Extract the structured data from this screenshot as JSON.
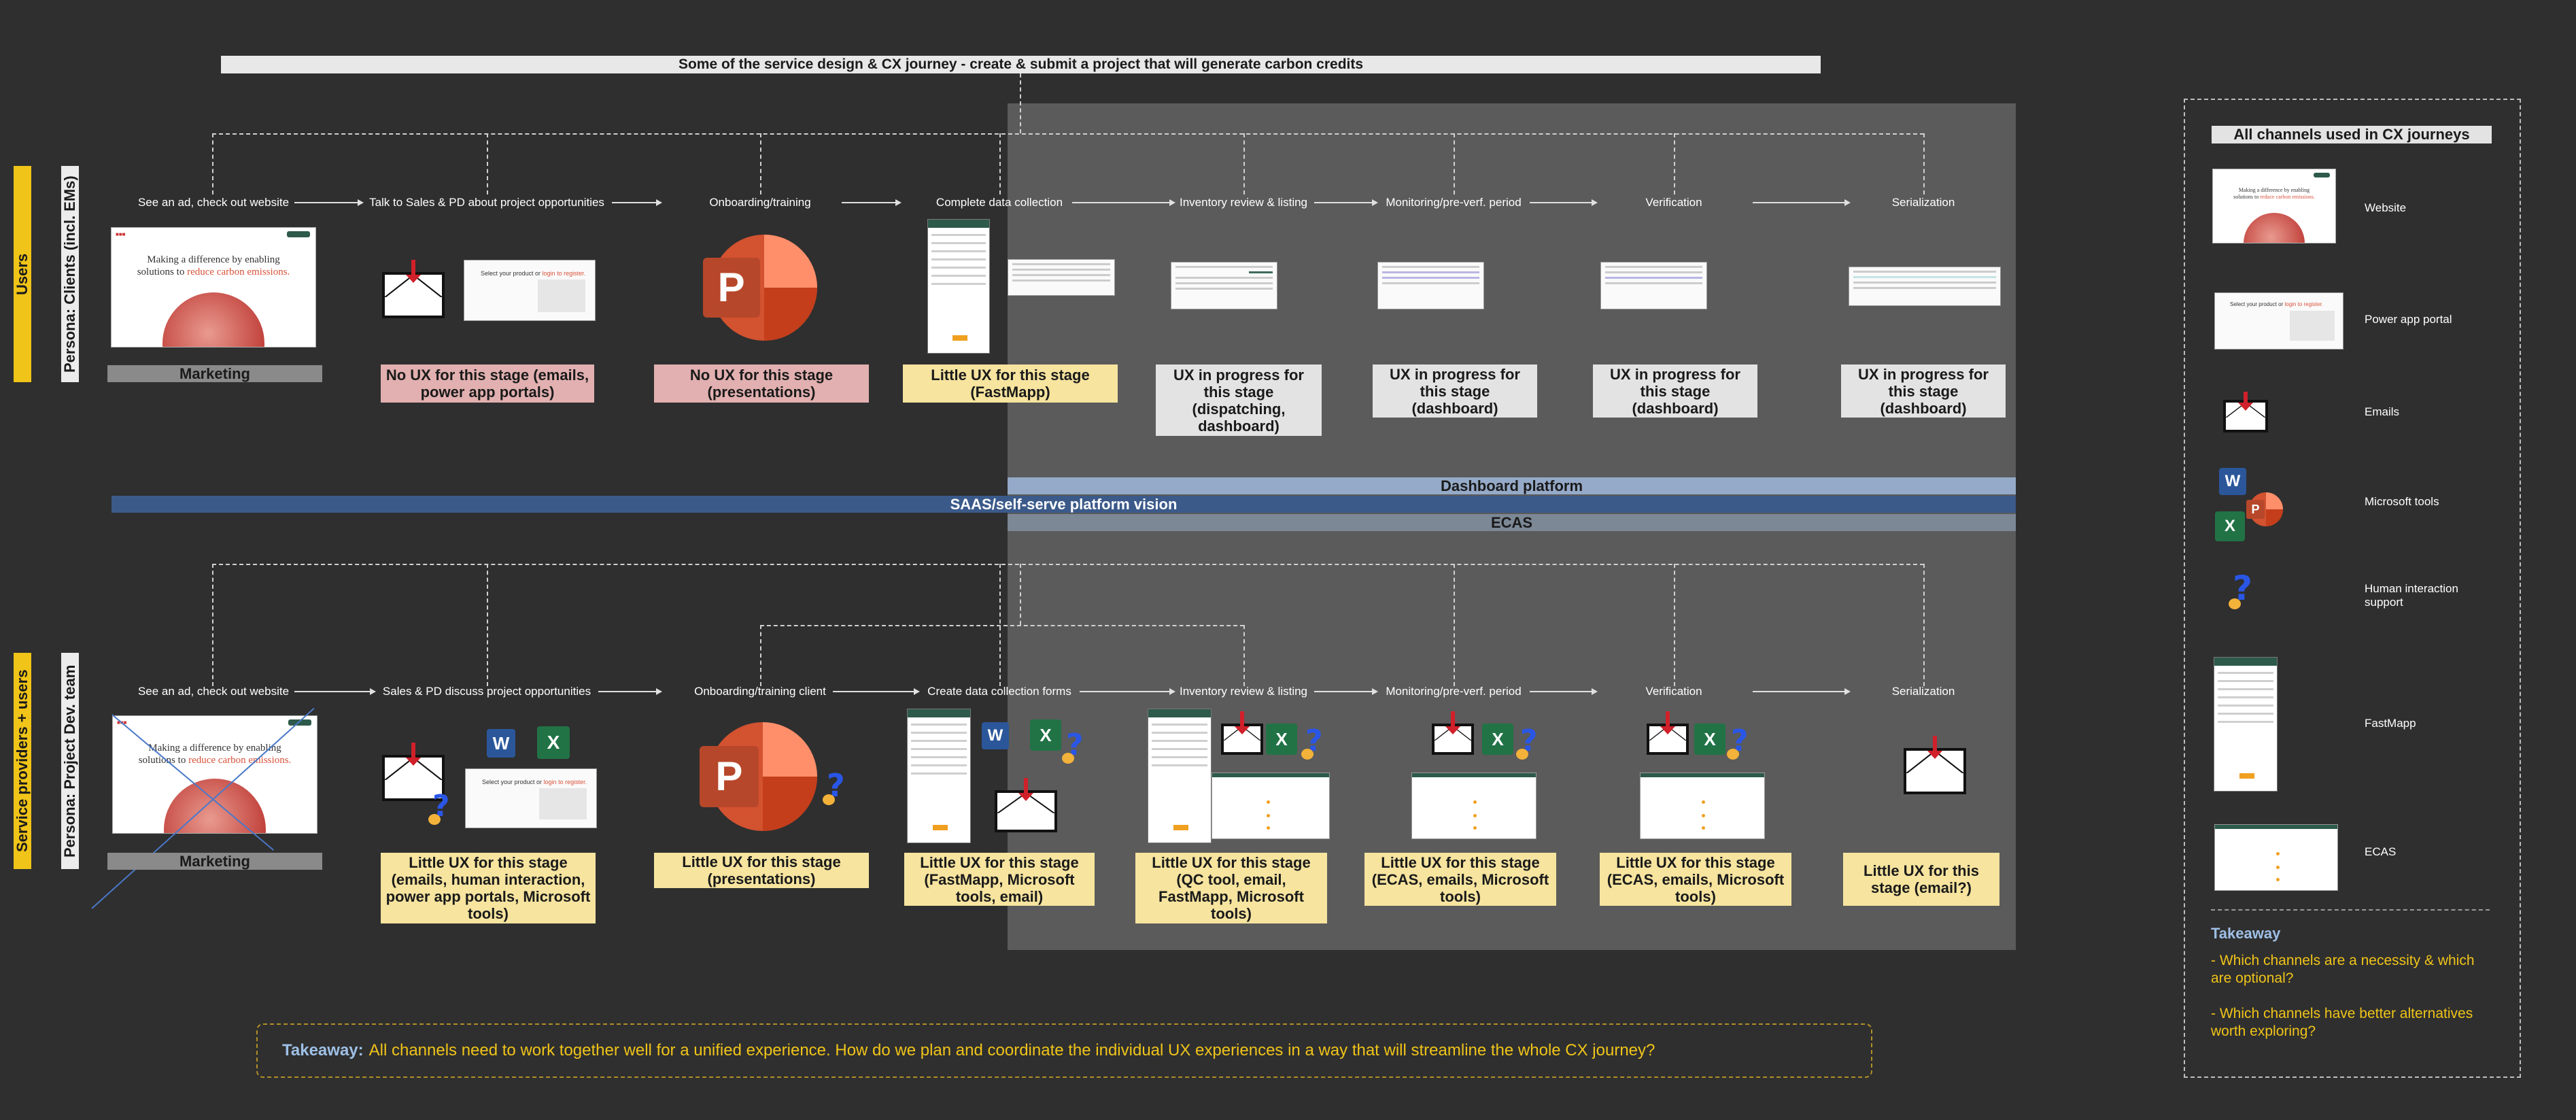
{
  "title": "Some of the service design & CX journey - create & submit a project that will generate carbon credits",
  "rows": {
    "users_label": "Users",
    "clients_label": "Persona: Clients (incl. EMs)",
    "providers_label": "Service providers + users",
    "pd_team_label": "Persona: Project Dev. team"
  },
  "top_stages": [
    "See an ad, check out website",
    "Talk to Sales & PD about project opportunities",
    "Onboarding/training",
    "Complete data collection",
    "Inventory review & listing",
    "Monitoring/pre-verf. period",
    "Verification",
    "Serialization"
  ],
  "bottom_stages": [
    "See an ad, check out website",
    "Sales & PD discuss project opportunities",
    "Onboarding/training client",
    "Create data collection forms",
    "Inventory review & listing",
    "Monitoring/pre-verf. period",
    "Verification",
    "Serialization"
  ],
  "top_boxes": [
    "Marketing",
    "No UX for this stage (emails, power app portals)",
    "No UX for this stage (presentations)",
    "Little UX for this stage (FastMapp)",
    "UX in progress for this stage (dispatching, dashboard)",
    "UX in progress for this stage (dashboard)",
    "UX in progress for this stage (dashboard)",
    "UX in progress for this stage (dashboard)"
  ],
  "bottom_boxes": [
    "Marketing",
    "Little UX for this stage (emails, human interaction, power app portals, Microsoft tools)",
    "Little UX for this stage (presentations)",
    "Little  UX for this stage (FastMapp, Microsoft tools, email)",
    "Little UX for this stage (QC tool, email, FastMapp, Microsoft tools)",
    "Little UX for this stage (ECAS, emails, Microsoft tools)",
    "Little UX for this stage (ECAS, emails, Microsoft tools)",
    "Little UX for this stage (email?)"
  ],
  "bands": {
    "dashboard": "Dashboard platform",
    "saas": "SAAS/self-serve platform vision",
    "ecas": "ECAS"
  },
  "website_mock": {
    "hero_line1": "Making a difference by enabling",
    "hero_line2a": "solutions to ",
    "hero_line2b": "reduce carbon emissions."
  },
  "portal_mock": {
    "text_a": "Select your product or ",
    "text_b": "login to register."
  },
  "icons": {
    "ppt": "P",
    "word": "W",
    "excel": "X",
    "help": "?"
  },
  "legend": {
    "title": "All channels used in CX journeys",
    "items": [
      "Website",
      "Power app portal",
      "Emails",
      "Microsoft tools",
      "Human interaction support",
      "FastMapp",
      "ECAS"
    ]
  },
  "side_takeaway": {
    "head": "Takeaway",
    "line1": "- Which channels are a necessity & which are optional?",
    "line2": "- Which channels have better alternatives worth exploring?"
  },
  "takeaway": {
    "head": "Takeaway:",
    "text": "All channels need to work together well for a unified experience. How do we plan and coordinate the individual UX experiences in a way that will streamline the whole CX journey?"
  },
  "colors": {
    "yellow": "#f0c419",
    "pink": "#e2b0b0",
    "note": "#f6e49f",
    "band_blue": "#3b5a8a",
    "band_light": "#95aac8",
    "band_grey": "#7d8896",
    "panel": "#5b5b5b"
  }
}
